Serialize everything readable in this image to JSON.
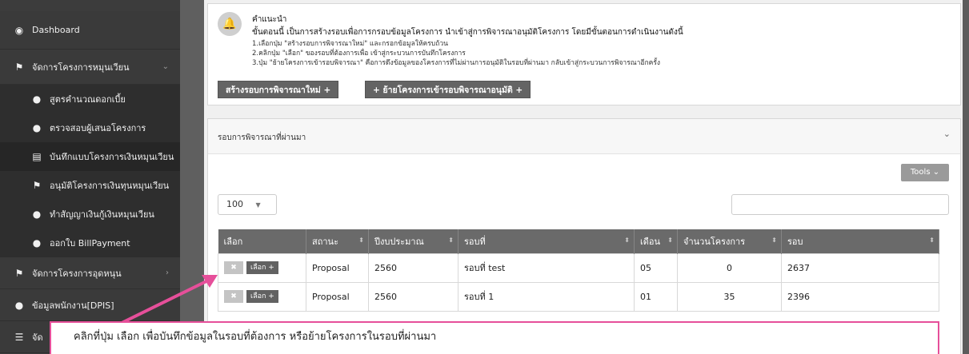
{
  "sidebar": {
    "items": [
      {
        "label": "Dashboard",
        "icon": "dashboard-icon"
      },
      {
        "label": "จัดการโครงการหมุนเวียน",
        "icon": "flag-icon"
      },
      {
        "label": "สูตรคำนวณดอกเบี้ย",
        "icon": "user-icon"
      },
      {
        "label": "ตรวจสอบผู้เสนอโครงการ",
        "icon": "user-icon"
      },
      {
        "label": "บันทึกแบบโครงการเงินหมุนเวียน",
        "icon": "book-icon"
      },
      {
        "label": "อนุมัติโครงการเงินทุนหมุนเวียน",
        "icon": "flag-icon"
      },
      {
        "label": "ทำสัญญาเงินกู้เงินหมุนเวียน",
        "icon": "user-icon"
      },
      {
        "label": "ออกใบ BillPayment",
        "icon": "user-icon"
      },
      {
        "label": "จัดการโครงการอุดหนุน",
        "icon": "flag-icon"
      },
      {
        "label": "ข้อมูลพนักงาน[DPIS]",
        "icon": "user-icon"
      },
      {
        "label": "จัด",
        "icon": "list-icon"
      }
    ]
  },
  "notice": {
    "title": "คำแนะนำ",
    "line1": "ขั้นตอนนี้ เป็นการสร้างรอบเพื่อการกรอบข้อมูลโครงการ นำเข้าสู่การพิจารณาอนุมัติโครงการ โดยมีขั้นตอนการดำเนินงานดังนี้",
    "step1": "1.เลือกปุ่ม \"สร้างรอบการพิจารณาใหม่\" และกรอกข้อมูลให้ครบถ้วน",
    "step2": "2.คลิกปุ่ม \"เลือก\" ของรอบที่ต้องการเพื่อ เข้าสู่กระบวนการบันทึกโครงการ",
    "step3": "3.ปุ่ม \"ย้ายโครงการเข้ารอบพิจารณา\" คือการดึงข้อมูลของโครงการที่ไม่ผ่านการอนุมัติในรอบที่ผ่านมา กลับเข้าสู่กระบวนการพิจารณาอีกครั้ง",
    "btn_new": "สร้างรอบการพิจารณาใหม่ +",
    "btn_move": "+ ย้ายโครงการเข้ารอบพิจารณาอนุมัติ +"
  },
  "panel": {
    "title": "รอบการพิจารณาที่ผ่านมา",
    "tools_label": "Tools ⌄",
    "page_size": "100",
    "columns": [
      "เลือก",
      "สถานะ",
      "ปีงบประมาณ",
      "รอบที่",
      "เดือน",
      "จำนวนโครงการ",
      "รอบ"
    ],
    "rows": [
      {
        "status": "Proposal",
        "year": "2560",
        "round": "รอบที่ test",
        "month": "05",
        "count": "0",
        "round_no": "2637"
      },
      {
        "status": "Proposal",
        "year": "2560",
        "round": "รอบที่ 1",
        "month": "01",
        "count": "35",
        "round_no": "2396"
      }
    ],
    "btn_select": "เลือก +",
    "btn_delete": "✖"
  },
  "callout": {
    "text": "คลิกที่ปุ่ม เลือก เพื่อบันทึกข้อมูลในรอบที่ต้องการ หรือย้ายโครงการในรอบที่ผ่านมา"
  },
  "colors": {
    "accent": "#e64f9a",
    "sidebar": "#3c3c3c",
    "header": "#6a6a6a"
  }
}
